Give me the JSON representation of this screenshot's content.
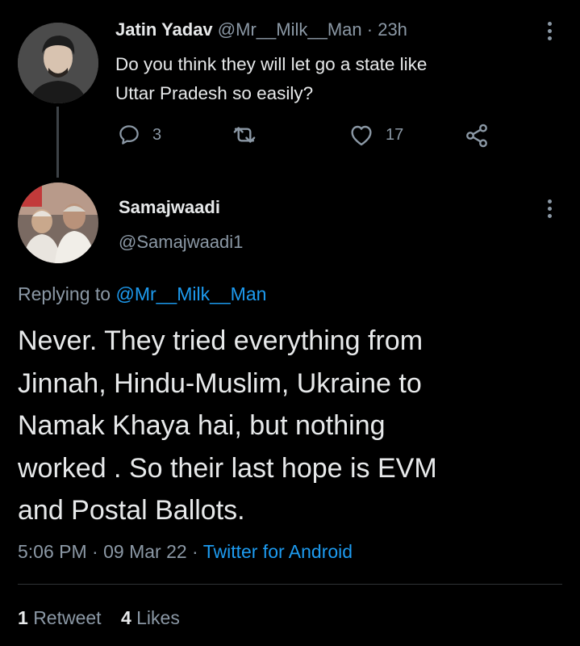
{
  "reply_tweet": {
    "author_name": "Jatin Yadav",
    "handle": "@Mr__Milk__Man",
    "separator": "·",
    "time": "23h",
    "text_line1": "Do you think they will let go a state like",
    "text_line2": "Uttar Pradesh so easily?",
    "reply_count": "3",
    "like_count": "17"
  },
  "main_tweet": {
    "author_name": "Samajwaadi",
    "handle": "@Samajwaadi1",
    "replying_prefix": "Replying to",
    "replying_handle": "@Mr__Milk__Man",
    "text_lines": [
      "Never. They tried everything from",
      "Jinnah, Hindu-Muslim, Ukraine to",
      "Namak Khaya hai, but nothing",
      "worked . So their last hope is EVM",
      "and Postal Ballots."
    ],
    "timestamp": "5:06 PM · 09 Mar 22 ·",
    "source": "Twitter for Android"
  },
  "stats": {
    "retweet_count": "1",
    "retweet_label": "Retweet",
    "like_count": "4",
    "like_label": "Likes"
  },
  "colors": {
    "background": "#000000",
    "text": "#e7e9ea",
    "muted": "#8b98a5",
    "link": "#1d9bf0"
  }
}
